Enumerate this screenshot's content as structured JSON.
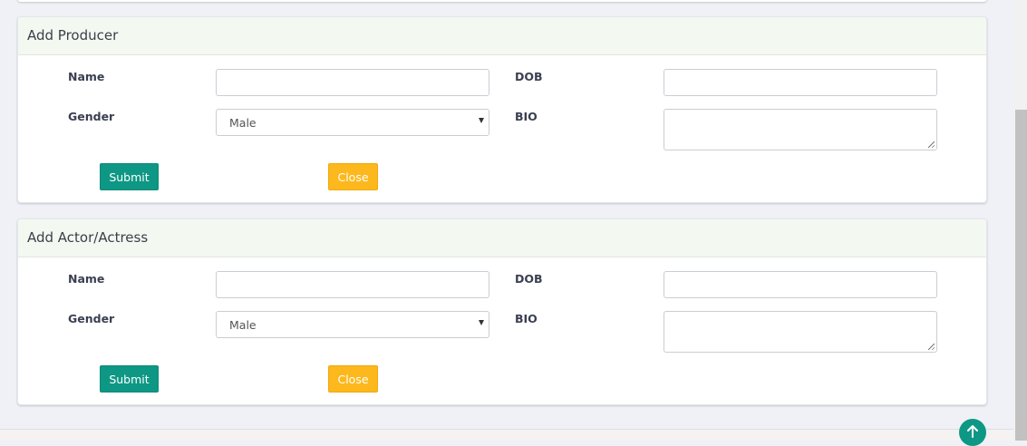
{
  "producer_form": {
    "title": "Add Producer",
    "name_label": "Name",
    "dob_label": "DOB",
    "gender_label": "Gender",
    "bio_label": "BIO",
    "gender_value": "Male",
    "submit_label": "Submit",
    "close_label": "Close"
  },
  "actor_form": {
    "title": "Add Actor/Actress",
    "name_label": "Name",
    "dob_label": "DOB",
    "gender_label": "Gender",
    "bio_label": "BIO",
    "gender_value": "Male",
    "submit_label": "Submit",
    "close_label": "Close"
  },
  "icons": {
    "scroll_top": "arrow-up-icon",
    "select_caret": "caret-down-icon"
  },
  "colors": {
    "submit": "#0f9785",
    "close": "#fdb81e",
    "header_bg": "#f3f8f1",
    "page_bg": "#eff1f6"
  }
}
